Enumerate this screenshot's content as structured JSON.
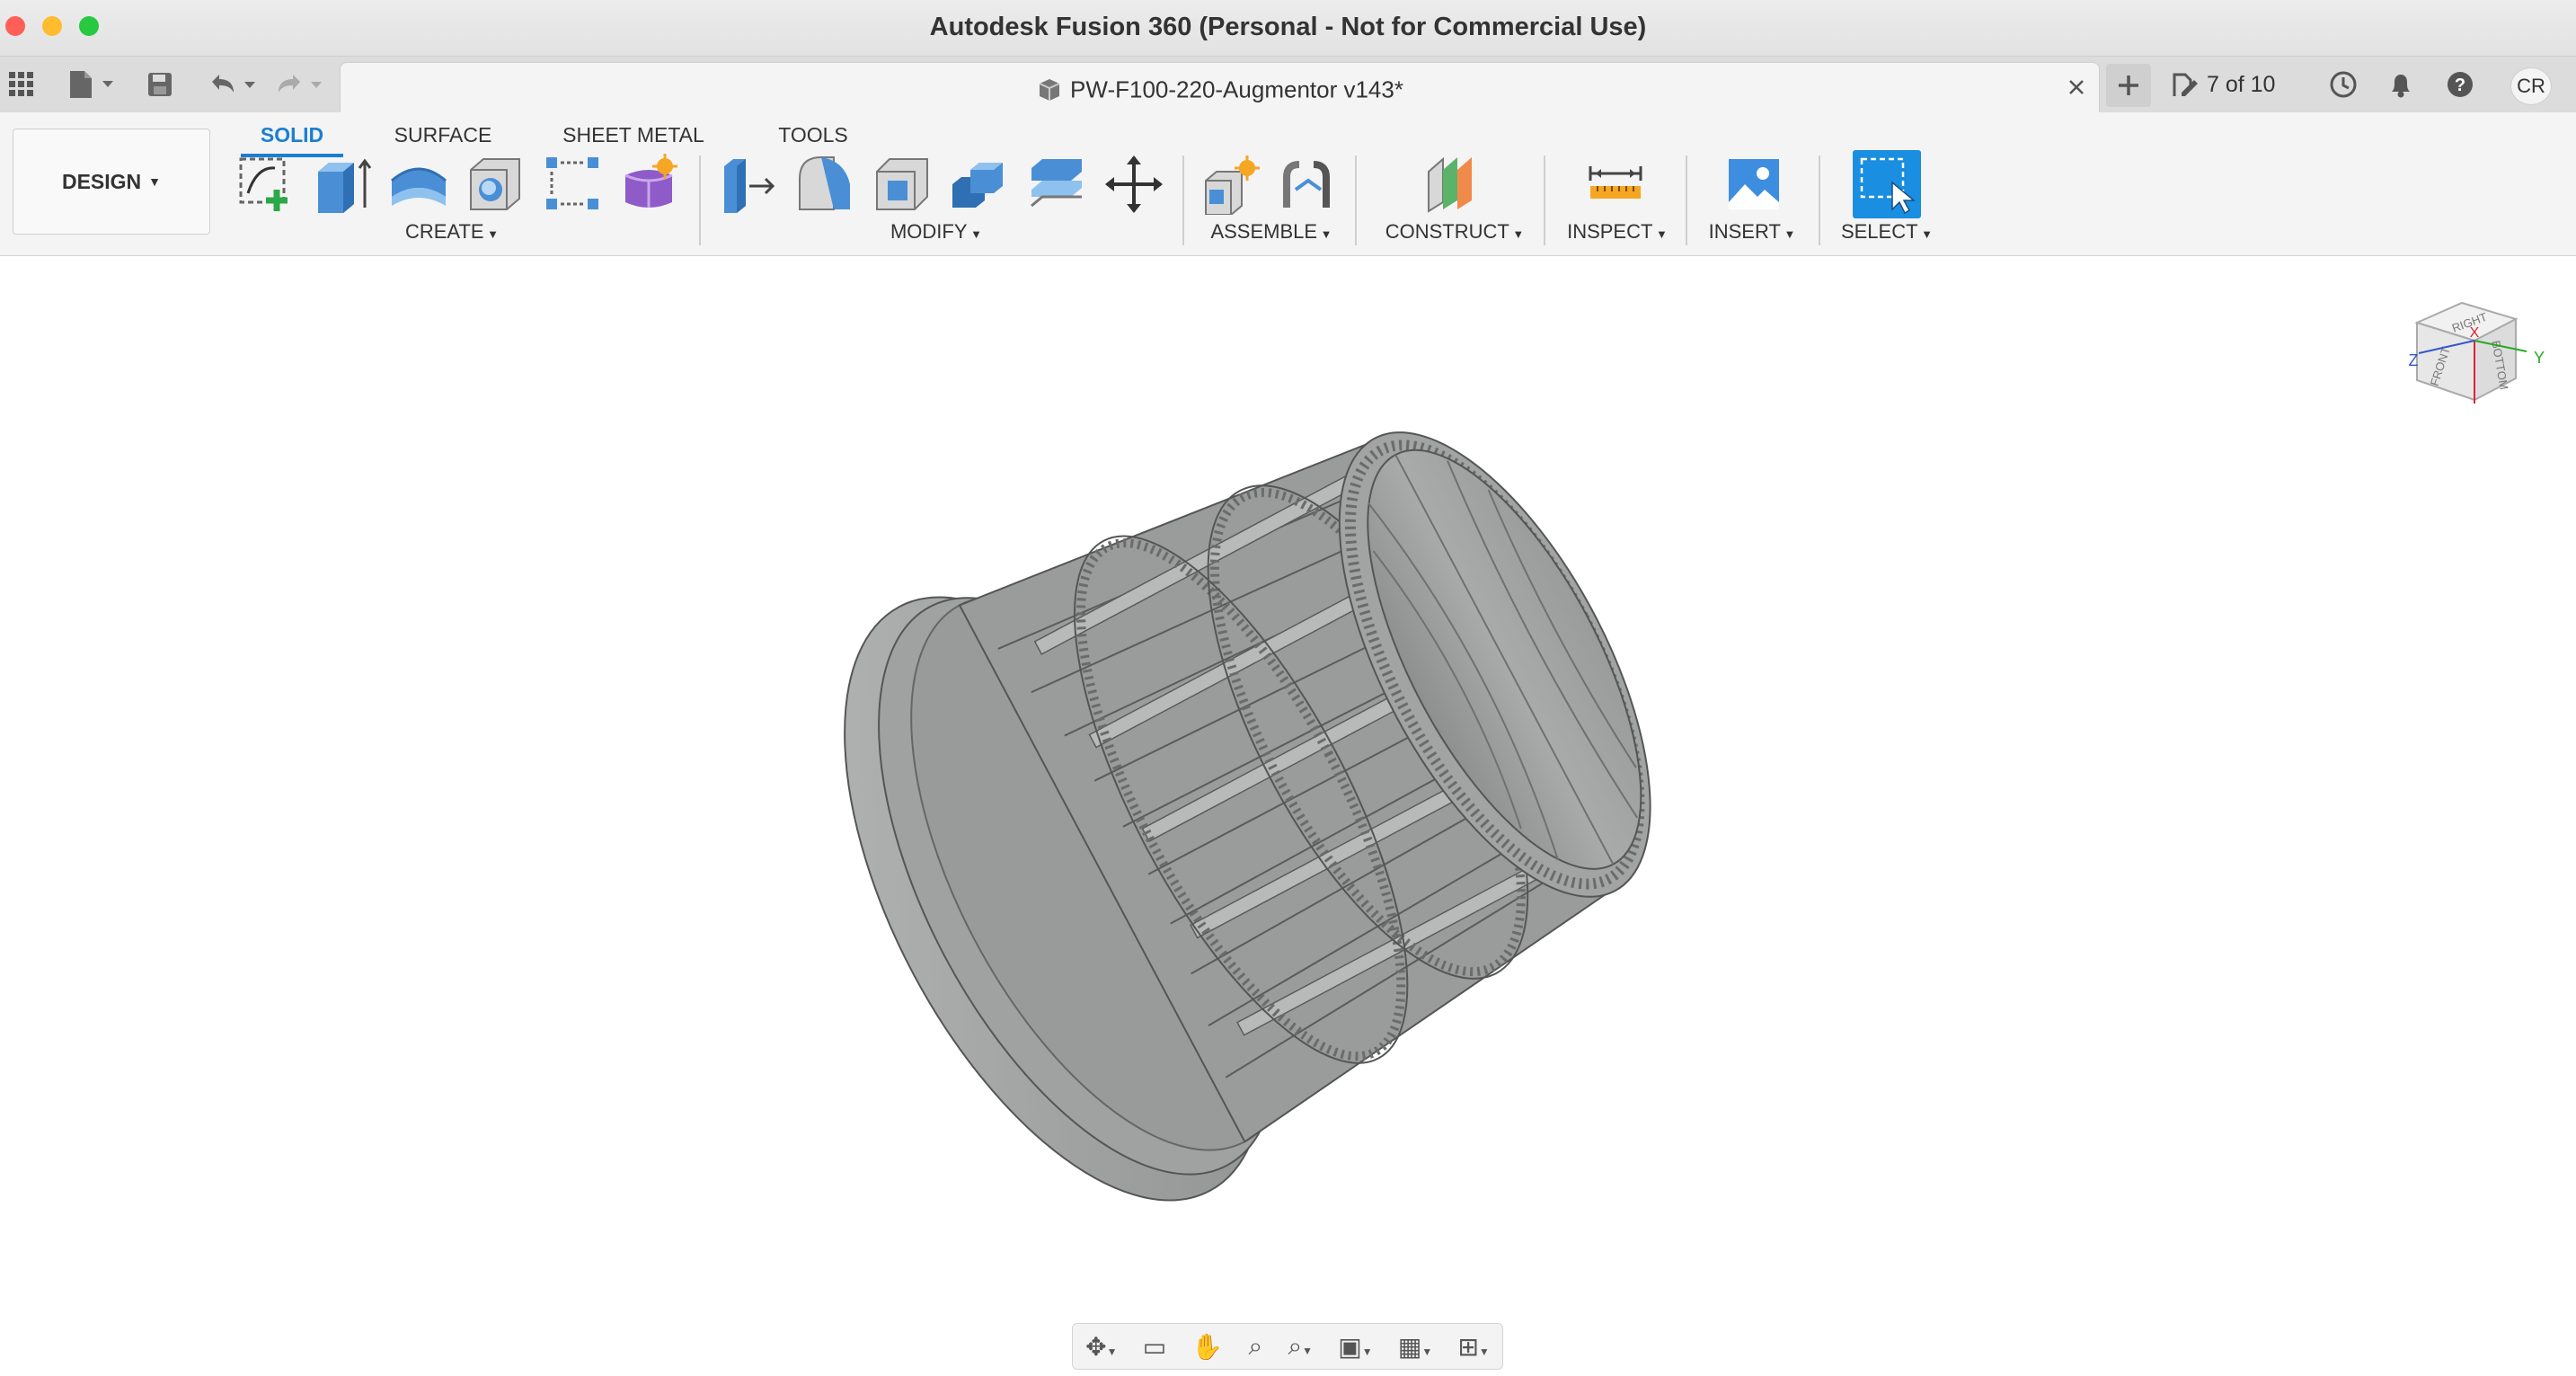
{
  "window": {
    "title": "Autodesk Fusion 360 (Personal - Not for Commercial Use)"
  },
  "tabbar": {
    "document_title": "PW-F100-220-Augmentor v143*",
    "job_status": "7 of 10",
    "user_initials": "CR"
  },
  "toolbar": {
    "workspace": "DESIGN",
    "tabs": [
      "SOLID",
      "SURFACE",
      "SHEET METAL",
      "TOOLS"
    ],
    "groups": {
      "create": "CREATE",
      "modify": "MODIFY",
      "assemble": "ASSEMBLE",
      "construct": "CONSTRUCT",
      "inspect": "INSPECT",
      "insert": "INSERT",
      "select": "SELECT"
    }
  },
  "viewcube": {
    "right": "RIGHT",
    "front": "FRONT",
    "bottom": "BOTTOM",
    "axis_x": "X",
    "axis_y": "Y",
    "axis_z": "Z"
  },
  "colors": {
    "accent": "#1a7fd1",
    "select_active": "#1a8ee0",
    "model_gray": "#9ea0a0",
    "close_red": "#ff5f57",
    "minimize_yellow": "#febc2e",
    "maximize_green": "#28c840"
  }
}
